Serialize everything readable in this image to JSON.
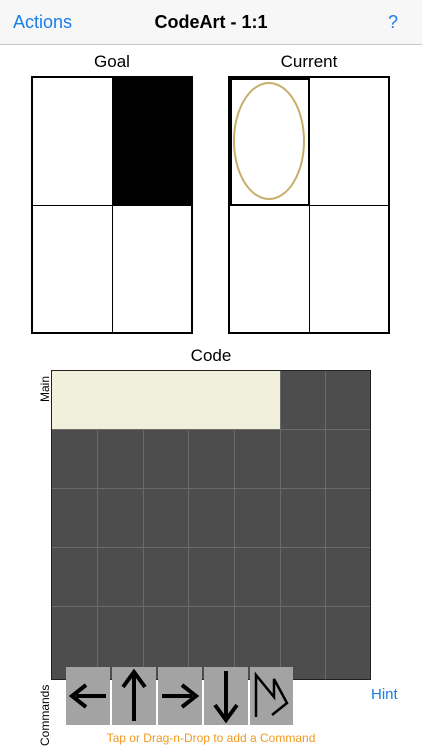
{
  "nav": {
    "left": "Actions",
    "title": "CodeArt - 1:1",
    "right": "?"
  },
  "goal": {
    "label": "Goal"
  },
  "current": {
    "label": "Current"
  },
  "code": {
    "label": "Code",
    "row_label": "Main"
  },
  "commands": {
    "label": "Commands",
    "items": [
      {
        "icon": "arrow-left-icon"
      },
      {
        "icon": "arrow-up-icon"
      },
      {
        "icon": "arrow-right-icon"
      },
      {
        "icon": "arrow-down-icon"
      },
      {
        "icon": "zigzag-icon"
      }
    ],
    "hint": "Hint",
    "instructions": "Tap or Drag-n-Drop to add a Command"
  },
  "colors": {
    "accent": "#1a7ee8",
    "instructions": "#f09a1f",
    "oval": "#c6ad68",
    "code_bg": "#4d4d4d",
    "main_strip": "#f1f0dc",
    "command_tile": "#a3a3a3"
  }
}
